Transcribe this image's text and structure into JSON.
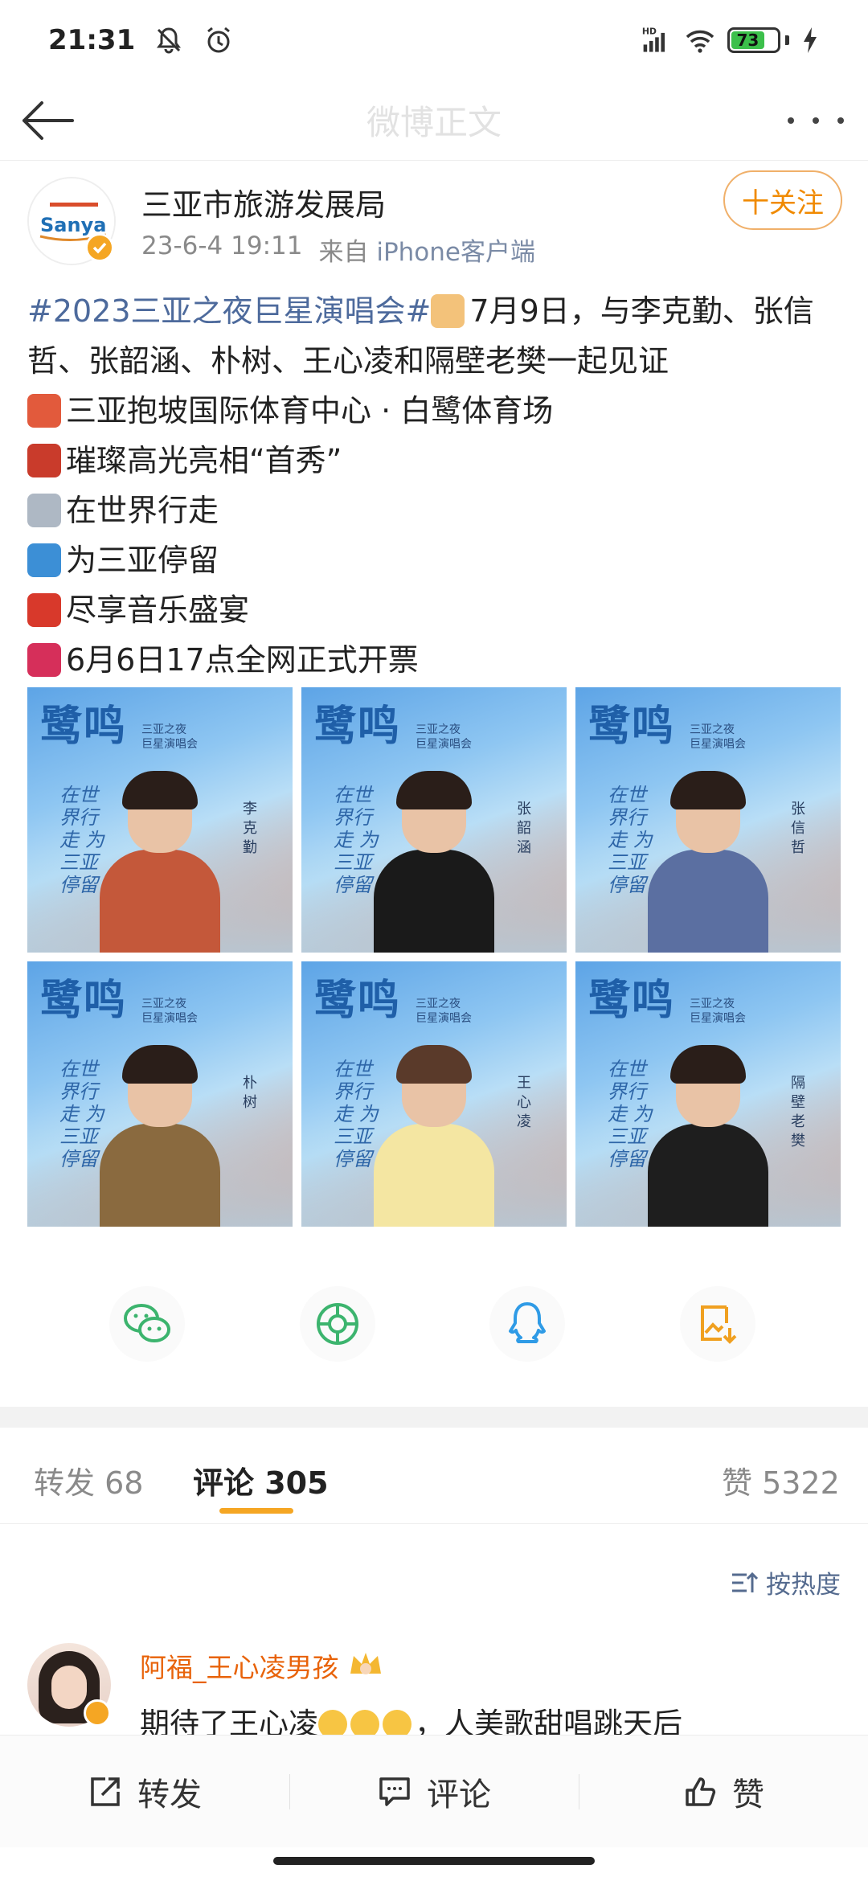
{
  "status_bar": {
    "time": "21:31",
    "network_label": "HD",
    "battery_level": "73"
  },
  "nav": {
    "title": "微博正文"
  },
  "post": {
    "author": "三亚市旅游发展局",
    "date": "23-6-4 19:11",
    "source_prefix": "来自",
    "source_client": "iPhone客户端",
    "follow_label": "十关注",
    "avatar_logo_text": "Sanya",
    "text": {
      "topic": "#2023三亚之夜巨星演唱会#",
      "line1_rest": "7月9日，与李克勤、张信",
      "line2": "哲、张韶涵、朴树、王心凌和隔壁老樊一起见证",
      "line3": "三亚抱坡国际体育中心 · 白鹭体育场",
      "line4": "璀璨高光亮相“首秀”",
      "line5": "在世界行走",
      "line6": "为三亚停留",
      "line7": "尽享音乐盛宴",
      "line8": "6月6日17点全网正式开票"
    },
    "images": [
      {
        "title": "鹭鸣",
        "subtitle": "三亚之夜\n巨星演唱会",
        "slogan": "在世界行走 为三亚停留",
        "name": "李克勤"
      },
      {
        "title": "鹭鸣",
        "subtitle": "三亚之夜\n巨星演唱会",
        "slogan": "在世界行走 为三亚停留",
        "name": "张韶涵"
      },
      {
        "title": "鹭鸣",
        "subtitle": "三亚之夜\n巨星演唱会",
        "slogan": "在世界行走 为三亚停留",
        "name": "张信哲"
      },
      {
        "title": "鹭鸣",
        "subtitle": "三亚之夜\n巨星演唱会",
        "slogan": "在世界行走 为三亚停留",
        "name": "朴树"
      },
      {
        "title": "鹭鸣",
        "subtitle": "三亚之夜\n巨星演唱会",
        "slogan": "在世界行走 为三亚停留",
        "name": "王心凌"
      },
      {
        "title": "鹭鸣",
        "subtitle": "三亚之夜\n巨星演唱会",
        "slogan": "在世界行走 为三亚停留",
        "name": "隔壁老樊"
      }
    ]
  },
  "share": {
    "items": [
      "wechat-icon",
      "moments-icon",
      "qq-icon",
      "save-image-icon"
    ]
  },
  "tabs": {
    "repost": "转发 68",
    "comment": "评论 305",
    "like": "赞 5322"
  },
  "sort_label": "按热度",
  "comments": [
    {
      "user": "阿福_王心凌男孩",
      "text_prefix": "期待了王心凌",
      "text_suffix": "，人美歌甜唱跳天后"
    }
  ],
  "bottom_bar": {
    "repost": "转发",
    "comment": "评论",
    "like": "赞"
  },
  "colors": {
    "accent": "#f5a623",
    "follow": "#f08a00",
    "topic": "#4d6a9c",
    "username": "#e8630a"
  }
}
